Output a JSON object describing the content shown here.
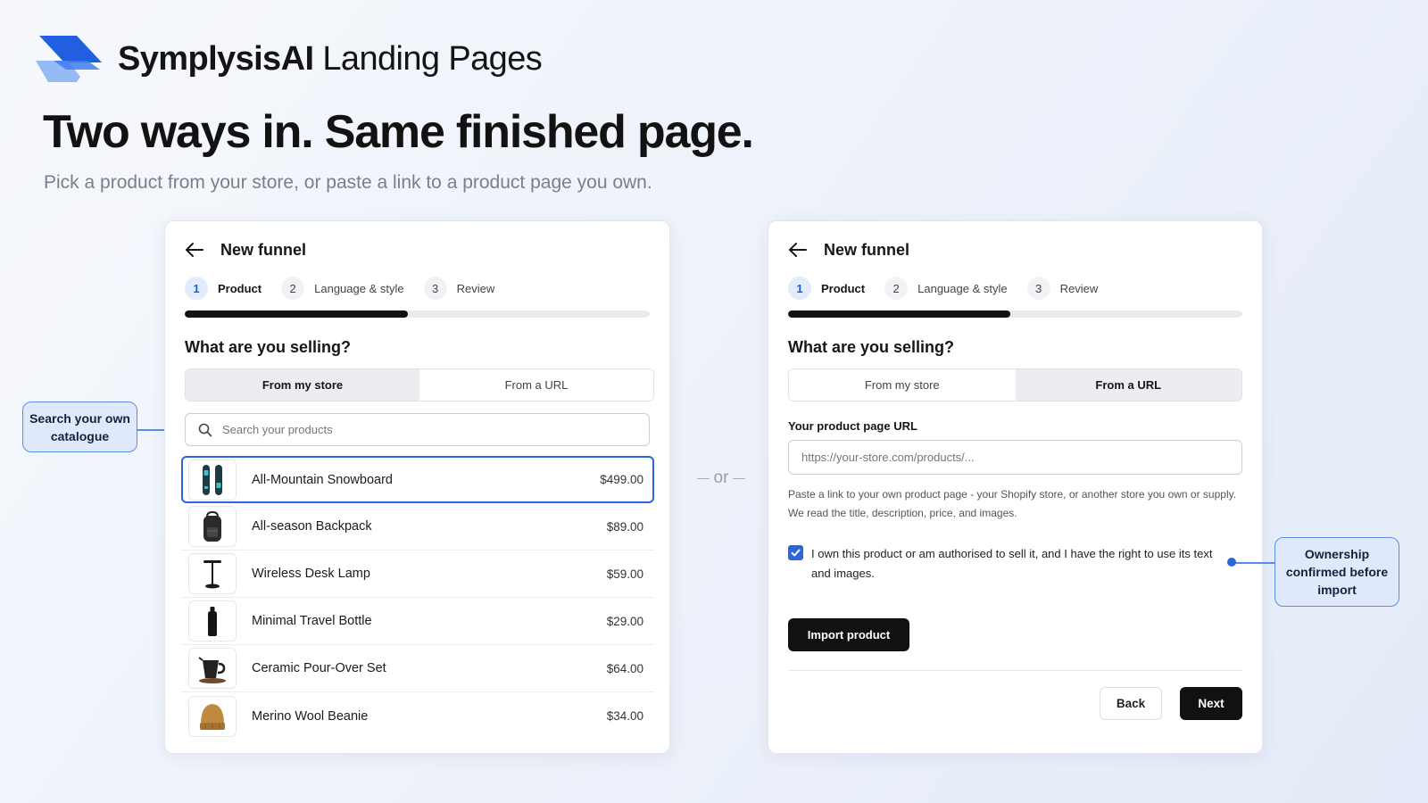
{
  "brand": {
    "name_bold": "SymplysisAI",
    "name_regular": "Landing Pages"
  },
  "headline": "Two ways in. Same finished page.",
  "subline": "Pick a product from your store, or paste a link to a product page you own.",
  "separator": "or",
  "steps": [
    {
      "num": "1",
      "label": "Product"
    },
    {
      "num": "2",
      "label": "Language & style"
    },
    {
      "num": "3",
      "label": "Review"
    }
  ],
  "left_card": {
    "title": "New funnel",
    "progress_fraction": 0.48,
    "question": "What are you selling?",
    "tabs": {
      "store": "From my store",
      "url": "From a URL",
      "active": "store"
    },
    "search": {
      "placeholder": "Search your products"
    },
    "products": [
      {
        "name": "All-Mountain Snowboard",
        "price": "$499.00",
        "icon": "snowboard-icon",
        "selected": true
      },
      {
        "name": "All-season Backpack",
        "price": "$89.00",
        "icon": "backpack-icon"
      },
      {
        "name": "Wireless Desk Lamp",
        "price": "$59.00",
        "icon": "desk-lamp-icon"
      },
      {
        "name": "Minimal Travel Bottle",
        "price": "$29.00",
        "icon": "bottle-icon"
      },
      {
        "name": "Ceramic Pour-Over Set",
        "price": "$64.00",
        "icon": "pour-over-icon"
      },
      {
        "name": "Merino Wool Beanie",
        "price": "$34.00",
        "icon": "beanie-icon"
      }
    ]
  },
  "right_card": {
    "title": "New funnel",
    "progress_fraction": 0.49,
    "question": "What are you selling?",
    "tabs": {
      "store": "From my store",
      "url": "From a URL",
      "active": "url"
    },
    "url_label": "Your product page URL",
    "url_placeholder": "https://your-store.com/products/...",
    "help_text": "Paste a link to your own product page - your Shopify store, or another store you own or supply. We read the title, description, price, and images.",
    "consent_checked": true,
    "consent_text": "I own this product or am authorised to sell it, and I have the right to use its text and images.",
    "import_button": "Import product",
    "back_button": "Back",
    "next_button": "Next"
  },
  "callouts": {
    "left": "Search your own catalogue",
    "right": "Ownership confirmed before import"
  },
  "colors": {
    "accent": "#2c67d9",
    "callout_bg": "#dfe9fb",
    "dark_button": "#111111"
  }
}
